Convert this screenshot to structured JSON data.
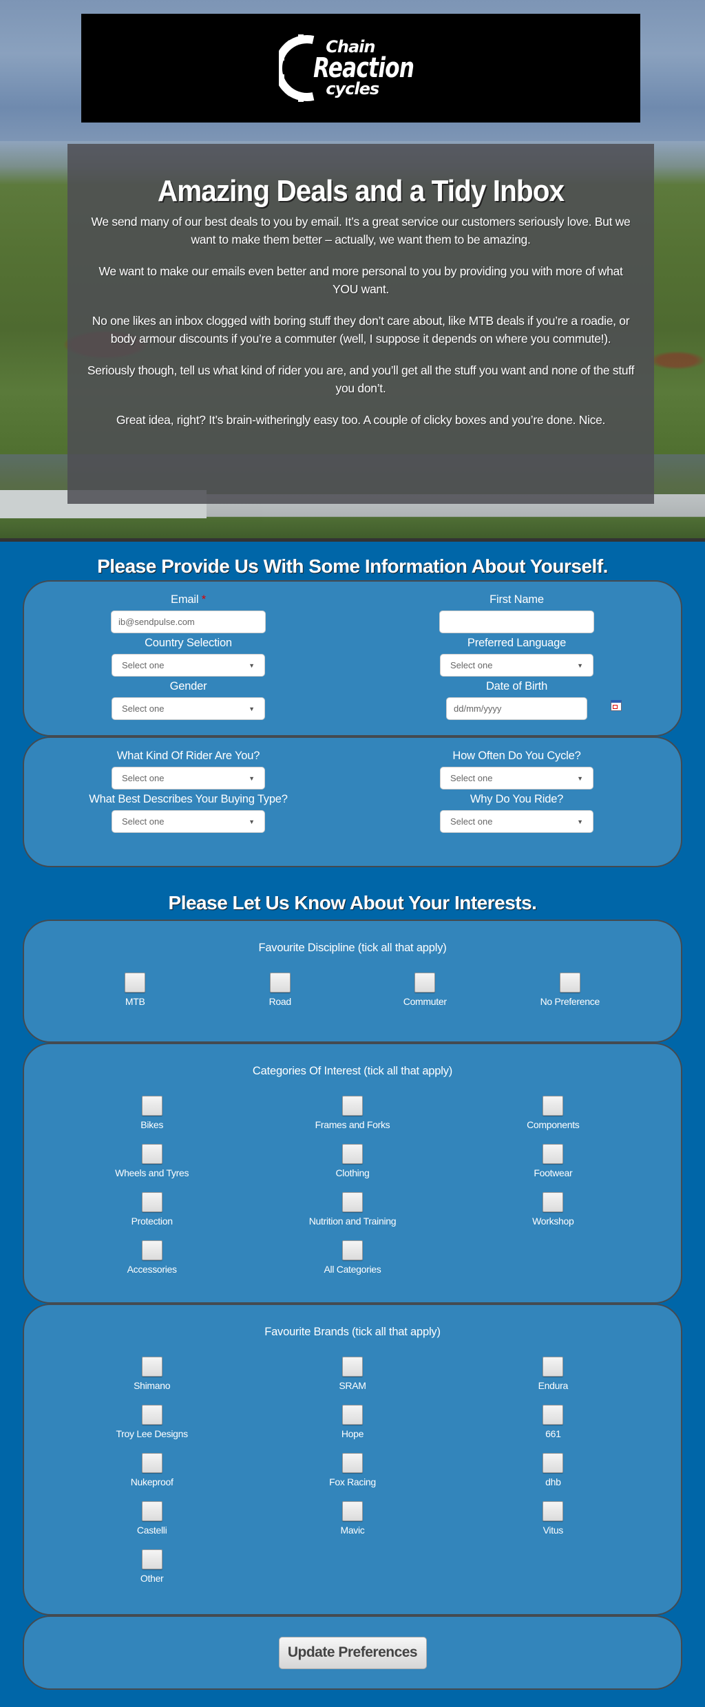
{
  "brand": {
    "logo_line1": "Chain",
    "logo_line2": "Reaction",
    "logo_line3": "cycles"
  },
  "intro": {
    "title": "Amazing Deals and a Tidy Inbox",
    "paragraphs": [
      "We send many of our best deals to you by email. It’s a great service our customers seriously love. But we want to make them better – actually, we want them to be amazing.",
      "We want to make our emails even better and more personal to you by providing you with more of what YOU want.",
      "No one likes an inbox clogged with boring stuff they don’t care about, like MTB deals if you’re a roadie, or body armour discounts if you’re a commuter (well, I suppose it depends on where you commute!).",
      "Seriously though, tell us what kind of rider you are, and you’ll get all the stuff you want and none of the stuff you don’t.",
      "Great idea, right? It’s brain-witheringly easy too. A couple of clicky boxes and you’re done. Nice."
    ]
  },
  "about_section": {
    "heading": "Please Provide Us With Some Information About Yourself.",
    "email": {
      "label": "Email",
      "required_mark": "*",
      "value": "ib@sendpulse.com"
    },
    "first_name": {
      "label": "First Name",
      "value": ""
    },
    "country": {
      "label": "Country Selection",
      "selected": "Select one"
    },
    "language": {
      "label": "Preferred Language",
      "selected": "Select one"
    },
    "gender": {
      "label": "Gender",
      "selected": "Select one"
    },
    "dob": {
      "label": "Date of Birth",
      "placeholder": "dd/mm/yyyy"
    },
    "rider_kind": {
      "label": "What Kind Of Rider Are You?",
      "selected": "Select one"
    },
    "cycle_frequency": {
      "label": "How Often Do You Cycle?",
      "selected": "Select one"
    },
    "buying_type": {
      "label": "What Best Describes Your Buying Type?",
      "selected": "Select one"
    },
    "why_ride": {
      "label": "Why Do You Ride?",
      "selected": "Select one"
    }
  },
  "interests_section": {
    "heading": "Please Let Us Know About Your Interests.",
    "discipline": {
      "title": "Favourite Discipline (tick all that apply)",
      "options": [
        "MTB",
        "Road",
        "Commuter",
        "No Preference"
      ]
    },
    "categories": {
      "title": "Categories Of Interest (tick all that apply)",
      "options": [
        "Bikes",
        "Frames and Forks",
        "Components",
        "Wheels and Tyres",
        "Clothing",
        "Footwear",
        "Protection",
        "Nutrition and Training",
        "Workshop",
        "Accessories",
        "All Categories"
      ]
    },
    "brands": {
      "title": "Favourite Brands (tick all that apply)",
      "options": [
        "Shimano",
        "SRAM",
        "Endura",
        "Troy Lee Designs",
        "Hope",
        "661",
        "Nukeproof",
        "Fox Racing",
        "dhb",
        "Castelli",
        "Mavic",
        "Vitus",
        "Other"
      ]
    }
  },
  "submit": {
    "label": "Update Preferences"
  }
}
